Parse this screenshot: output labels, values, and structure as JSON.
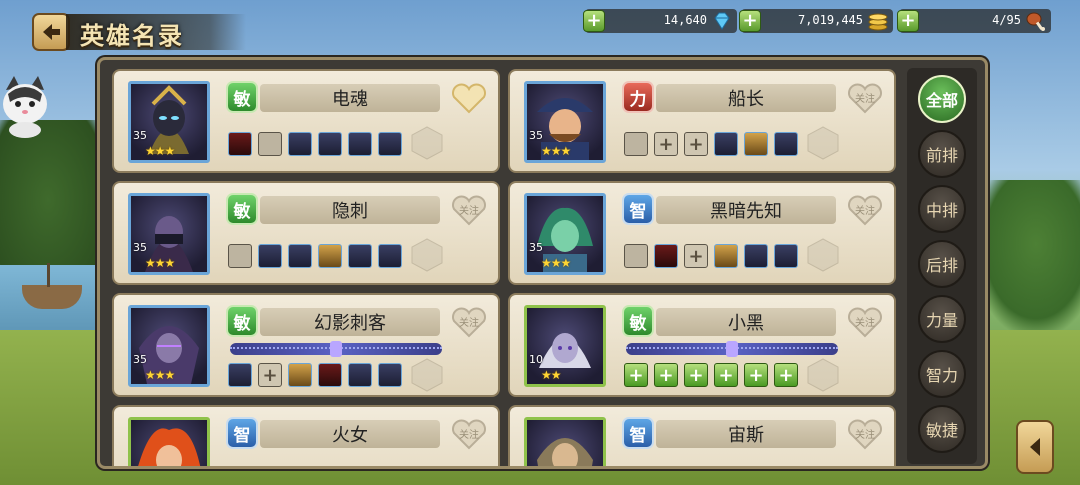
{
  "header": {
    "title": "英雄名录"
  },
  "resources": {
    "diamonds": "14,640",
    "gold": "7,019,445",
    "stamina": "4/95"
  },
  "heroes": [
    {
      "name": "电魂",
      "attr": "敏",
      "level": "35",
      "stars": "★★★",
      "fav": ""
    },
    {
      "name": "船长",
      "attr": "力",
      "level": "35",
      "stars": "★★★",
      "fav": "关注"
    },
    {
      "name": "隐刺",
      "attr": "敏",
      "level": "35",
      "stars": "★★★",
      "fav": "关注"
    },
    {
      "name": "黑暗先知",
      "attr": "智",
      "level": "35",
      "stars": "★★★",
      "fav": "关注"
    },
    {
      "name": "幻影刺客",
      "attr": "敏",
      "level": "35",
      "stars": "★★★",
      "fav": "关注"
    },
    {
      "name": "小黑",
      "attr": "敏",
      "level": "10",
      "stars": "★★",
      "fav": "关注"
    },
    {
      "name": "火女",
      "attr": "智",
      "level": "",
      "stars": "",
      "fav": "关注"
    },
    {
      "name": "宙斯",
      "attr": "智",
      "level": "",
      "stars": "",
      "fav": "关注"
    }
  ],
  "filters": [
    "全部",
    "前排",
    "中排",
    "后排",
    "力量",
    "智力",
    "敏捷"
  ],
  "slot_plus": "+"
}
